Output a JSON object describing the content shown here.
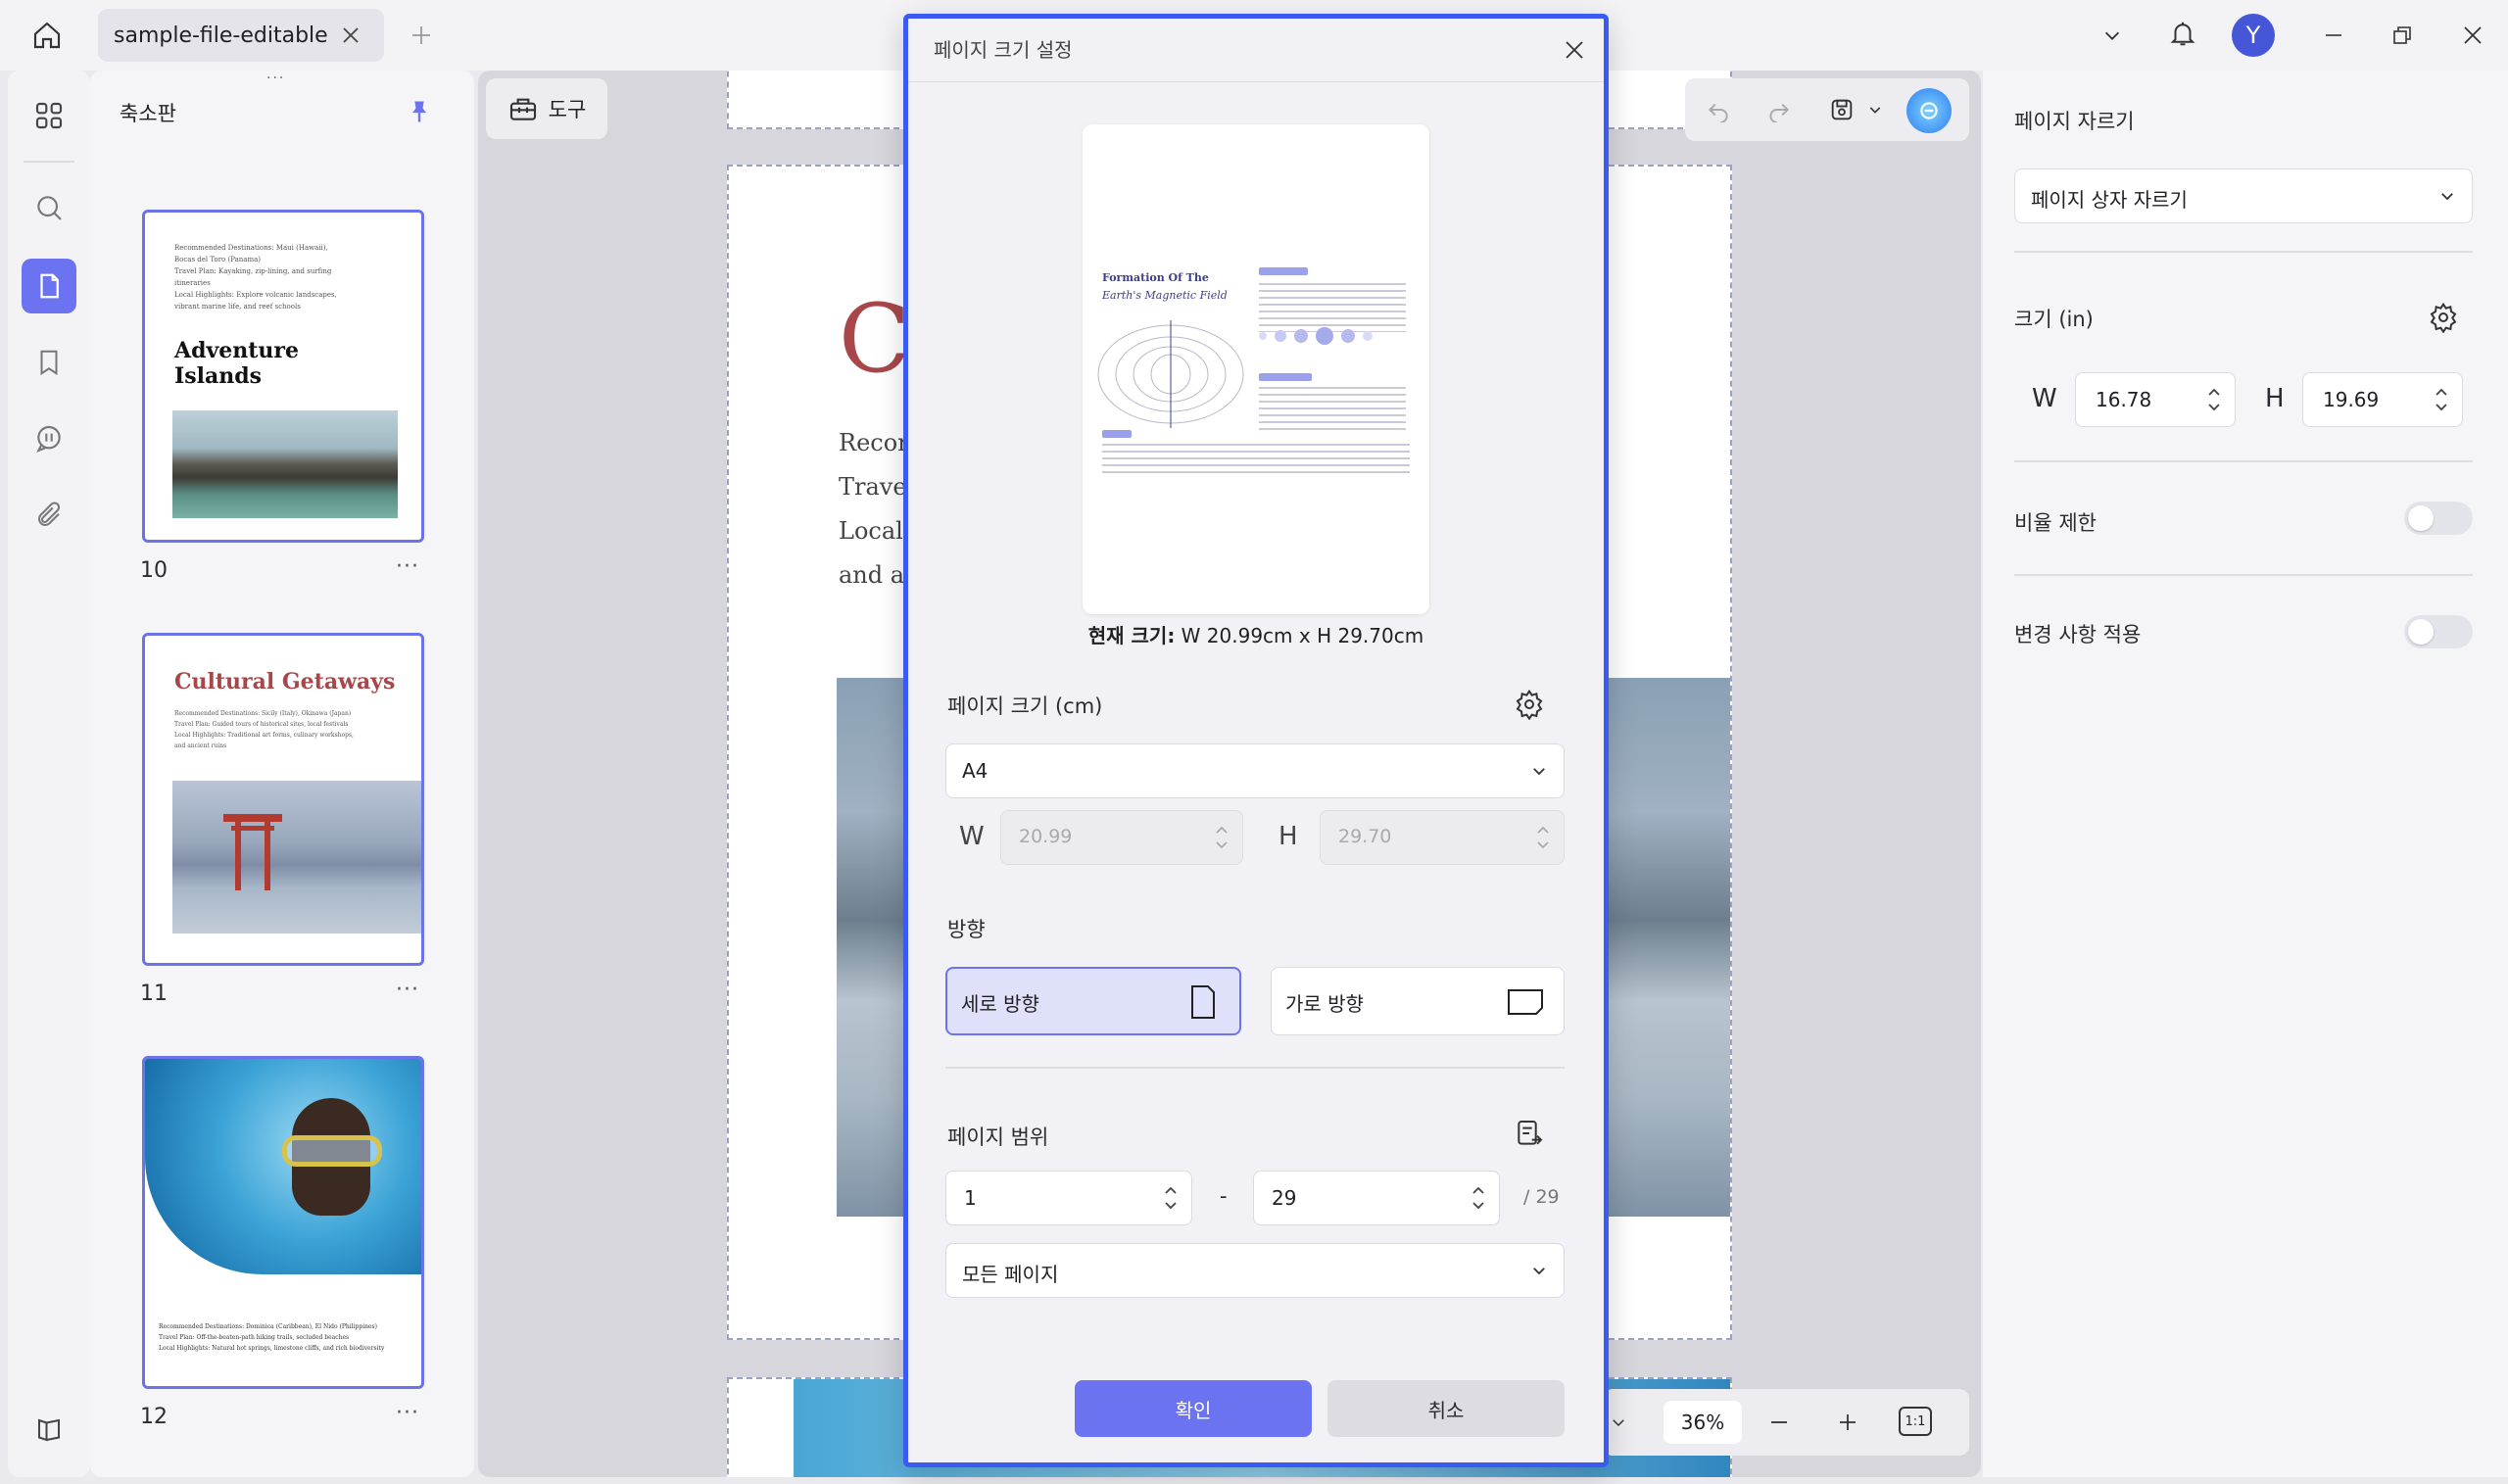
{
  "titlebar": {
    "tab_title": "sample-file-editable",
    "avatar_letter": "Y"
  },
  "thumbnails": {
    "panel_title": "축소판",
    "pages": [
      {
        "number": "10",
        "heading": "Adventure Islands",
        "lines": [
          "Recommended Destinations: Maui (Hawaii),",
          "Bocas del Toro (Panama)",
          "Travel Plan: Kayaking, zip-lining, and surfing",
          "itineraries",
          "Local Highlights: Explore volcanic landscapes,",
          "vibrant marine life, and reef schools"
        ]
      },
      {
        "number": "11",
        "heading": "Cultural Getaways",
        "lines": [
          "Recommended Destinations: Sicily (Italy), Okinawa (Japan)",
          "Travel Plan: Guided tours of historical sites, local festivals",
          "Local Highlights: Traditional art forms, culinary workshops,",
          "and ancient ruins"
        ]
      },
      {
        "number": "12",
        "heading": "",
        "lines": [
          "Recommended Destinations: Dominica (Caribbean), El Nido (Philippines)",
          "Travel Plan: Off-the-beaten-path hiking trails, secluded beaches",
          "Local Highlights: Natural hot springs, limestone cliffs, and rich biodiversity"
        ]
      }
    ],
    "more_label": "···"
  },
  "toolbar": {
    "tools_label": "도구"
  },
  "document": {
    "big_letter": "C",
    "lines": [
      "Recor",
      "Trave",
      "Local",
      "and a"
    ]
  },
  "zoom": {
    "value": "36%",
    "fit_label": "1:1"
  },
  "right_panel": {
    "crop_title": "페이지 자르기",
    "crop_mode": "페이지 상자 자르기",
    "size_title": "크기 (in)",
    "w_label": "W",
    "w_value": "16.78",
    "h_label": "H",
    "h_value": "19.69",
    "ratio_label": "비율 제한",
    "apply_label": "변경 사항 적용"
  },
  "modal": {
    "title": "페이지 크기 설정",
    "preview": {
      "heading_line1": "Formation Of The",
      "heading_line2": "Earth's Magnetic Field"
    },
    "current_size_prefix": "현재 크기:",
    "current_size_value": "W 20.99cm x H 29.70cm",
    "page_size_label": "페이지 크기 (cm)",
    "page_size_value": "A4",
    "w_label": "W",
    "w_value": "20.99",
    "h_label": "H",
    "h_value": "29.70",
    "orientation_label": "방향",
    "portrait_label": "세로 방향",
    "landscape_label": "가로 방향",
    "range_label": "페이지 범위",
    "range_from": "1",
    "range_dash": "-",
    "range_to": "29",
    "range_total": "/ 29",
    "range_mode": "모든 페이지",
    "confirm_label": "확인",
    "cancel_label": "취소"
  },
  "colors": {
    "accent": "#6b73f0",
    "modal_border": "#3b5bf0",
    "thumb_border": "#6b73e8",
    "heading_red": "#a8474a"
  }
}
